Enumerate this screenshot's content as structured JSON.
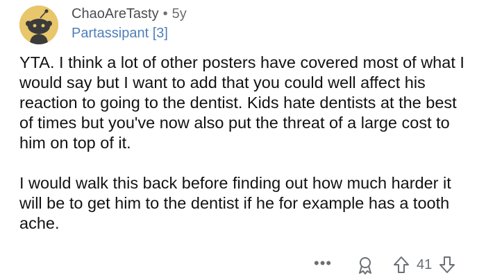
{
  "comment": {
    "author": "ChaoAreTasty",
    "separator": "•",
    "age": "5y",
    "flair": "Partassipant [3]",
    "paragraphs": [
      "YTA. I think a lot of other posters have covered most of what I would say but I want to add that you could well affect his reaction to going to the dentist. Kids hate dentists at the best of times but you've now also put the threat of a large cost to him on top of it.",
      "I would walk this back before finding out how much harder it will be to get him to the dentist if he for example has a tooth ache."
    ],
    "actions": {
      "more_label": "•••",
      "score": "41",
      "icons": [
        "more-icon",
        "award-icon",
        "upvote-icon",
        "downvote-icon"
      ]
    },
    "colors": {
      "avatar_bg": "#e8c66b",
      "flair": "#4d7fb8",
      "meta": "#6b6f73"
    }
  }
}
